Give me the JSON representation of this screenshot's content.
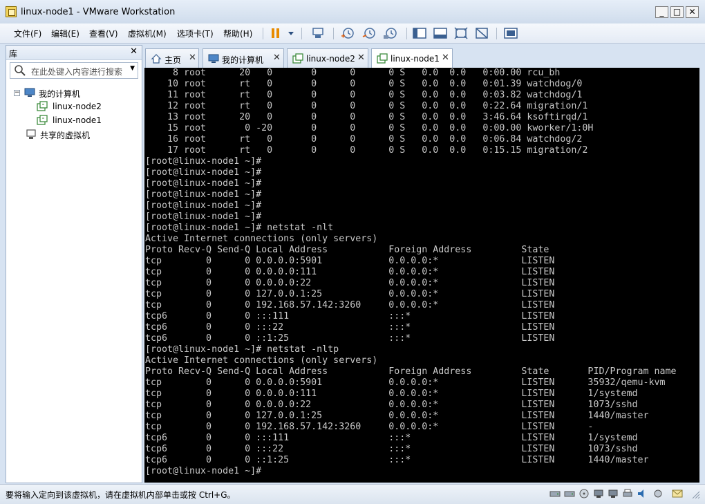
{
  "window": {
    "title": "linux-node1 - VMware Workstation"
  },
  "menu": [
    "文件(F)",
    "编辑(E)",
    "查看(V)",
    "虚拟机(M)",
    "选项卡(T)",
    "帮助(H)"
  ],
  "library": {
    "title": "库",
    "search_placeholder": "在此处键入内容进行搜索",
    "tree": {
      "root": "我的计算机",
      "children": [
        "linux-node2",
        "linux-node1"
      ],
      "shared": "共享的虚拟机"
    }
  },
  "tabs": [
    "主页",
    "我的计算机",
    "linux-node2",
    "linux-node1"
  ],
  "console": {
    "lines": [
      "     8 root      20   0       0      0      0 S   0.0  0.0   0:00.00 rcu_bh",
      "    10 root      rt   0       0      0      0 S   0.0  0.0   0:01.39 watchdog/0",
      "    11 root      rt   0       0      0      0 S   0.0  0.0   0:03.82 watchdog/1",
      "    12 root      rt   0       0      0      0 S   0.0  0.0   0:22.64 migration/1",
      "    13 root      20   0       0      0      0 S   0.0  0.0   3:46.64 ksoftirqd/1",
      "    15 root       0 -20       0      0      0 S   0.0  0.0   0:00.00 kworker/1:0H",
      "    16 root      rt   0       0      0      0 S   0.0  0.0   0:06.84 watchdog/2",
      "    17 root      rt   0       0      0      0 S   0.0  0.0   0:15.15 migration/2",
      "[root@linux-node1 ~]#",
      "[root@linux-node1 ~]#",
      "[root@linux-node1 ~]#",
      "[root@linux-node1 ~]#",
      "[root@linux-node1 ~]#",
      "[root@linux-node1 ~]#",
      "[root@linux-node1 ~]# netstat -nlt",
      "Active Internet connections (only servers)",
      "Proto Recv-Q Send-Q Local Address           Foreign Address         State",
      "tcp        0      0 0.0.0.0:5901            0.0.0.0:*               LISTEN",
      "tcp        0      0 0.0.0.0:111             0.0.0.0:*               LISTEN",
      "tcp        0      0 0.0.0.0:22              0.0.0.0:*               LISTEN",
      "tcp        0      0 127.0.0.1:25            0.0.0.0:*               LISTEN",
      "tcp        0      0 192.168.57.142:3260     0.0.0.0:*               LISTEN",
      "tcp6       0      0 :::111                  :::*                    LISTEN",
      "tcp6       0      0 :::22                   :::*                    LISTEN",
      "tcp6       0      0 ::1:25                  :::*                    LISTEN",
      "[root@linux-node1 ~]# netstat -nltp",
      "Active Internet connections (only servers)",
      "Proto Recv-Q Send-Q Local Address           Foreign Address         State       PID/Program name",
      "tcp        0      0 0.0.0.0:5901            0.0.0.0:*               LISTEN      35932/qemu-kvm",
      "tcp        0      0 0.0.0.0:111             0.0.0.0:*               LISTEN      1/systemd",
      "tcp        0      0 0.0.0.0:22              0.0.0.0:*               LISTEN      1073/sshd",
      "tcp        0      0 127.0.0.1:25            0.0.0.0:*               LISTEN      1440/master",
      "tcp        0      0 192.168.57.142:3260     0.0.0.0:*               LISTEN      -",
      "tcp6       0      0 :::111                  :::*                    LISTEN      1/systemd",
      "tcp6       0      0 :::22                   :::*                    LISTEN      1073/sshd",
      "tcp6       0      0 ::1:25                  :::*                    LISTEN      1440/master",
      "[root@linux-node1 ~]#"
    ]
  },
  "status": {
    "text": "要将输入定向到该虚拟机，请在虚拟机内部单击或按 Ctrl+G。"
  }
}
